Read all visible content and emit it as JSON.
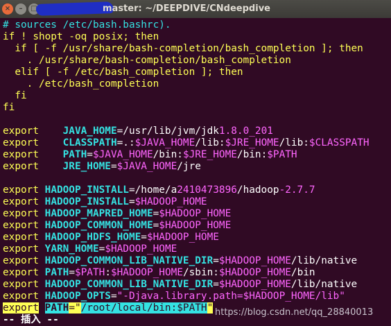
{
  "window": {
    "title": "master: ~/DEEPDIVE/CNdeepdive",
    "buttons": {
      "close": "×",
      "min": "–",
      "max": "□"
    }
  },
  "terminal": {
    "lines": [
      [
        "cmt",
        "# sources /etc/bash.bashrc)."
      ],
      [
        "kw",
        "if ! shopt -oq posix; then"
      ],
      [
        "kw",
        "  if [ -f /usr/share/bash-completion/bash_completion ]; then"
      ],
      [
        "kw",
        "    . /usr/share/bash-completion/bash_completion"
      ],
      [
        "kw",
        "  elif [ -f /etc/bash_completion ]; then"
      ],
      [
        "kw",
        "    . /etc/bash_completion"
      ],
      [
        "kw",
        "  fi"
      ],
      [
        "kw",
        "fi"
      ],
      [
        "white",
        ""
      ]
    ],
    "exports": [
      {
        "pre": "export",
        "sp": "    ",
        "name": "JAVA_HOME",
        "parts": [
          [
            "white",
            "=/usr/lib/jvm/jdk"
          ],
          [
            "num",
            "1.8.0_201"
          ]
        ]
      },
      {
        "pre": "export",
        "sp": "    ",
        "name": "CLASSPATH",
        "parts": [
          [
            "white",
            "=.:"
          ],
          [
            "dollar",
            "$JAVA_HOME"
          ],
          [
            "white",
            "/lib:"
          ],
          [
            "dollar",
            "$JRE_HOME"
          ],
          [
            "white",
            "/lib:"
          ],
          [
            "dollar",
            "$CLASSPATH"
          ]
        ]
      },
      {
        "pre": "export",
        "sp": "    ",
        "name": "PATH",
        "parts": [
          [
            "white",
            "="
          ],
          [
            "dollar",
            "$JAVA_HOME"
          ],
          [
            "white",
            "/bin:"
          ],
          [
            "dollar",
            "$JRE_HOME"
          ],
          [
            "white",
            "/bin:"
          ],
          [
            "dollar",
            "$PATH"
          ]
        ]
      },
      {
        "pre": "export",
        "sp": "    ",
        "name": "JRE_HOME",
        "parts": [
          [
            "white",
            "="
          ],
          [
            "dollar",
            "$JAVA_HOME"
          ],
          [
            "white",
            "/jre"
          ]
        ]
      },
      null,
      {
        "pre": "export",
        "sp": " ",
        "name": "HADOOP_INSTALL",
        "parts": [
          [
            "white",
            "=/home/a"
          ],
          [
            "num",
            "2410473896"
          ],
          [
            "white",
            "/hadoop"
          ],
          [
            "num",
            "-2.7.7"
          ]
        ]
      },
      {
        "pre": "export",
        "sp": " ",
        "name": "HADOOP_INSTALL",
        "parts": [
          [
            "white",
            "="
          ],
          [
            "dollar",
            "$HADOOP_HOME"
          ]
        ]
      },
      {
        "pre": "export",
        "sp": " ",
        "name": "HADOOP_MAPRED_HOME",
        "parts": [
          [
            "white",
            "="
          ],
          [
            "dollar",
            "$HADOOP_HOME"
          ]
        ]
      },
      {
        "pre": "export",
        "sp": " ",
        "name": "HADOOP_COMMON_HOME",
        "parts": [
          [
            "white",
            "="
          ],
          [
            "dollar",
            "$HADOOP_HOME"
          ]
        ]
      },
      {
        "pre": "export",
        "sp": " ",
        "name": "HADOOP_HDFS_HOME",
        "parts": [
          [
            "white",
            "="
          ],
          [
            "dollar",
            "$HADOOP_HOME"
          ]
        ]
      },
      {
        "pre": "export",
        "sp": " ",
        "name": "YARN_HOME",
        "parts": [
          [
            "white",
            "="
          ],
          [
            "dollar",
            "$HADOOP_HOME"
          ]
        ]
      },
      {
        "pre": "export",
        "sp": " ",
        "name": "HADOOP_COMMON_LIB_NATIVE_DIR",
        "parts": [
          [
            "white",
            "="
          ],
          [
            "dollar",
            "$HADOOP_HOME"
          ],
          [
            "white",
            "/lib/native"
          ]
        ]
      },
      {
        "pre": "export",
        "sp": " ",
        "name": "PATH",
        "parts": [
          [
            "white",
            "="
          ],
          [
            "dollar",
            "$PATH"
          ],
          [
            "white",
            ":"
          ],
          [
            "dollar",
            "$HADOOP_HOME"
          ],
          [
            "white",
            "/sbin:"
          ],
          [
            "dollar",
            "$HADOOP_HOME"
          ],
          [
            "white",
            "/bin"
          ]
        ]
      },
      {
        "pre": "export",
        "sp": " ",
        "name": "HADOOP_COMMON_LIB_NATIVE_DIR",
        "parts": [
          [
            "white",
            "="
          ],
          [
            "dollar",
            "$HADOOP_HOME"
          ],
          [
            "white",
            "/lib/native"
          ]
        ]
      },
      {
        "pre": "export",
        "sp": " ",
        "name": "HADOOP_OPTS",
        "parts": [
          [
            "white",
            "="
          ],
          [
            "str",
            "\"-Djava.library.path="
          ],
          [
            "dollar",
            "$HADOOP_HOME"
          ],
          [
            "str",
            "/lib\""
          ]
        ]
      }
    ],
    "highlighted_line": {
      "pre": "export",
      "sp": " ",
      "name": "PATH",
      "parts": [
        [
          "hl-str",
          "=\""
        ],
        [
          "hl-plain",
          "/root/local/bin:"
        ],
        [
          "hl-plain",
          "$PATH"
        ],
        [
          "hl-str",
          "\""
        ]
      ]
    },
    "mode_line": "-- 插入 --"
  },
  "watermark": "https://blog.csdn.net/qq_28840013"
}
